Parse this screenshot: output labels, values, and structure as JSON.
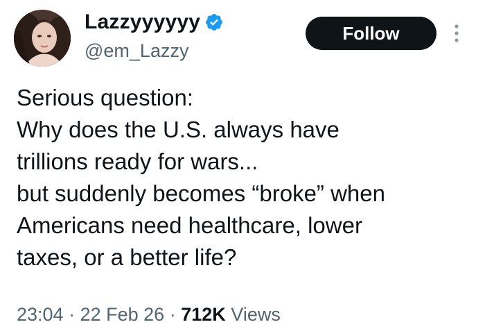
{
  "author": {
    "display_name": "Lazzyyyyyy",
    "handle": "@em_Lazzy",
    "verified": true,
    "verified_color": "#1d9bf0"
  },
  "actions": {
    "follow_label": "Follow"
  },
  "tweet": {
    "lines": [
      "Serious question:",
      "Why does the U.S. always have",
      "trillions ready for wars...",
      "but suddenly becomes “broke” when",
      "Americans need healthcare, lower",
      "taxes, or a better life?"
    ]
  },
  "meta": {
    "time": "23:04",
    "separator": "·",
    "date": "22 Feb 26",
    "views_count": "712K",
    "views_label": "Views"
  },
  "icons": {
    "verified": "verified-badge-icon",
    "more": "more-options-icon"
  }
}
